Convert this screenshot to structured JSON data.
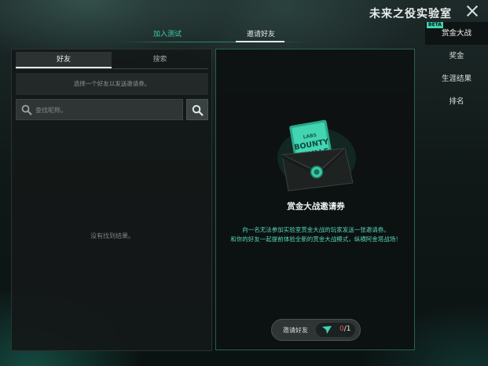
{
  "window": {
    "title": "未来之役实验室"
  },
  "top_tabs": [
    {
      "label": "加入测试",
      "state": "inactive"
    },
    {
      "label": "邀请好友",
      "state": "active"
    }
  ],
  "right_nav": {
    "items": [
      {
        "label": "赏金大战",
        "badge": "BETA",
        "active": true
      },
      {
        "label": "奖金"
      },
      {
        "label": "生涯结果"
      },
      {
        "label": "排名"
      }
    ]
  },
  "friends_panel": {
    "tabs": [
      {
        "label": "好友",
        "active": true
      },
      {
        "label": "搜索"
      }
    ],
    "hint": "选择一个好友以发送邀请券。",
    "search": {
      "placeholder": "查找昵称。",
      "value": ""
    },
    "empty_message": "没有找到结果。"
  },
  "invite_card": {
    "title": "赏金大战邀请券",
    "description_line1": "向一名无法参加实验室赏金大战的玩家发送一张邀请券。",
    "description_line2": "和你的好友一起提前体验全新的赏金大战模式，纵横阿金塔战场！",
    "envelope_text": [
      "LABS",
      "BOUNTY",
      "ROYALE"
    ],
    "button": {
      "label": "邀请好友",
      "sent": "0",
      "separator": "/",
      "total": "1"
    }
  },
  "colors": {
    "accent": "#3fd4b2",
    "description": "#55d7bb",
    "counter_zero": "#e05656",
    "panel_border": "#2a5f57"
  },
  "icons": [
    "close-icon",
    "search-icon",
    "paper-plane-icon",
    "envelope-icon"
  ]
}
